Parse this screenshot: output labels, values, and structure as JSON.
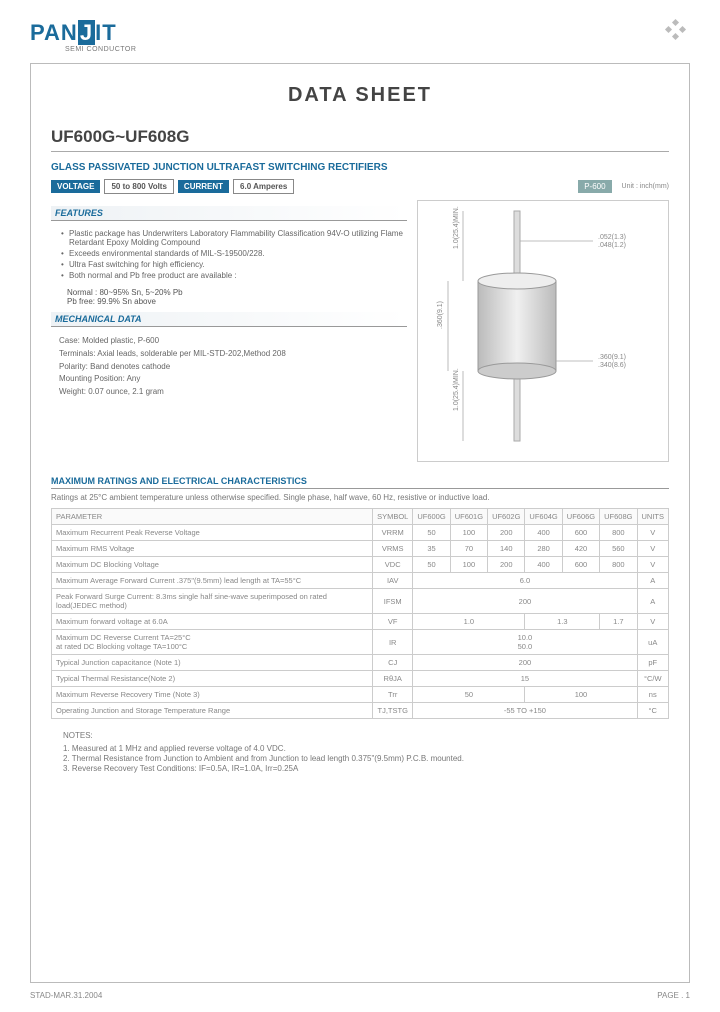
{
  "brand": {
    "name1": "PAN",
    "name2": "J",
    "name3": "IT",
    "sub": "SEMI CONDUCTOR"
  },
  "doc": {
    "title": "DATA  SHEET",
    "part": "UF600G~UF608G",
    "desc": "GLASS PASSIVATED JUNCTION ULTRAFAST SWITCHING RECTIFIERS",
    "voltage_label": "VOLTAGE",
    "voltage_val": "50 to 800 Volts",
    "current_label": "CURRENT",
    "current_val": "6.0 Amperes",
    "package": "P-600",
    "unit": "Unit : inch(mm)"
  },
  "features": {
    "title": "FEATURES",
    "items": [
      "Plastic package has Underwriters Laboratory Flammability Classification 94V-O utilizing Flame Retardant Epoxy Molding Compound",
      "Exceeds environmental standards of MIL-S-19500/228.",
      "Ultra Fast switching for high efficiency.",
      "Both normal and Pb free product are available :"
    ],
    "subitems": [
      "Normal : 80~95% Sn, 5~20% Pb",
      "Pb free: 99.9% Sn above"
    ]
  },
  "mechanical": {
    "title": "MECHANICAL DATA",
    "case": "Case: Molded plastic, P-600",
    "terminals": "Terminals: Axial leads, solderable per MIL-STD-202,Method 208",
    "polarity": "Polarity: Band denotes cathode",
    "mounting": "Mounting Position: Any",
    "weight": "Weight: 0.07 ounce, 2.1 gram"
  },
  "dimensions": {
    "lead_len": "1.0(25.4)MIN.",
    "lead_dia1": ".052(1.3)",
    "lead_dia2": ".048(1.2)",
    "body_h1": ".360(9.1)",
    "body_h2": ".340(8.6)",
    "body_d1": ".360(9.1)",
    "body_d2": ".340(8.6)"
  },
  "ratings": {
    "title": "MAXIMUM RATINGS AND ELECTRICAL CHARACTERISTICS",
    "note": "Ratings at 25°C ambient temperature unless otherwise specified.  Single phase, half wave, 60 Hz, resistive or inductive load.",
    "headers": [
      "PARAMETER",
      "SYMBOL",
      "UF600G",
      "UF601G",
      "UF602G",
      "UF604G",
      "UF606G",
      "UF608G",
      "UNITS"
    ],
    "rows": [
      {
        "p": "Maximum Recurrent Peak Reverse Voltage",
        "s": "VRRM",
        "v": [
          "50",
          "100",
          "200",
          "400",
          "600",
          "800"
        ],
        "u": "V"
      },
      {
        "p": "Maximum RMS Voltage",
        "s": "VRMS",
        "v": [
          "35",
          "70",
          "140",
          "280",
          "420",
          "560"
        ],
        "u": "V"
      },
      {
        "p": "Maximum DC Blocking Voltage",
        "s": "VDC",
        "v": [
          "50",
          "100",
          "200",
          "400",
          "600",
          "800"
        ],
        "u": "V"
      },
      {
        "p": "Maximum Average Forward Current .375\"(9.5mm) lead length at TA=55°C",
        "s": "IAV",
        "span": "6.0",
        "u": "A"
      },
      {
        "p": "Peak Forward Surge Current: 8.3ms single half sine-wave superimposed on rated load(JEDEC method)",
        "s": "IFSM",
        "span": "200",
        "u": "A"
      },
      {
        "p": "Maximum forward voltage at 6.0A",
        "s": "VF",
        "v3": [
          "1.0",
          "1.3",
          "1.7"
        ],
        "u": "V"
      },
      {
        "p": "Maximum DC Reverse Current TA=25°C\nat rated DC Blocking voltage   TA=100°C",
        "s": "IR",
        "span": "10.0\n50.0",
        "u": "uA"
      },
      {
        "p": "Typical Junction capacitance (Note 1)",
        "s": "CJ",
        "span": "200",
        "u": "pF"
      },
      {
        "p": "Typical Thermal Resistance(Note 2)",
        "s": "RθJA",
        "span": "15",
        "u": "°C/W"
      },
      {
        "p": "Maximum Reverse Recovery Time (Note 3)",
        "s": "Trr",
        "v2": [
          "50",
          "100"
        ],
        "u": "ns"
      },
      {
        "p": "Operating Junction and Storage Temperature Range",
        "s": "TJ,TSTG",
        "span": "-55 TO +150",
        "u": "°C"
      }
    ]
  },
  "notes": {
    "title": "NOTES:",
    "n1": "1. Measured at 1 MHz and applied reverse voltage of 4.0 VDC.",
    "n2": "2. Thermal Resistance from Junction to Ambient and from Junction to lead length 0.375\"(9.5mm) P.C.B. mounted.",
    "n3": "3. Reverse Recovery Test Conditions: IF=0.5A, IR=1.0A, Irr=0.25A"
  },
  "footer": {
    "date": "STAD-MAR.31.2004",
    "page": "PAGE .  1"
  }
}
